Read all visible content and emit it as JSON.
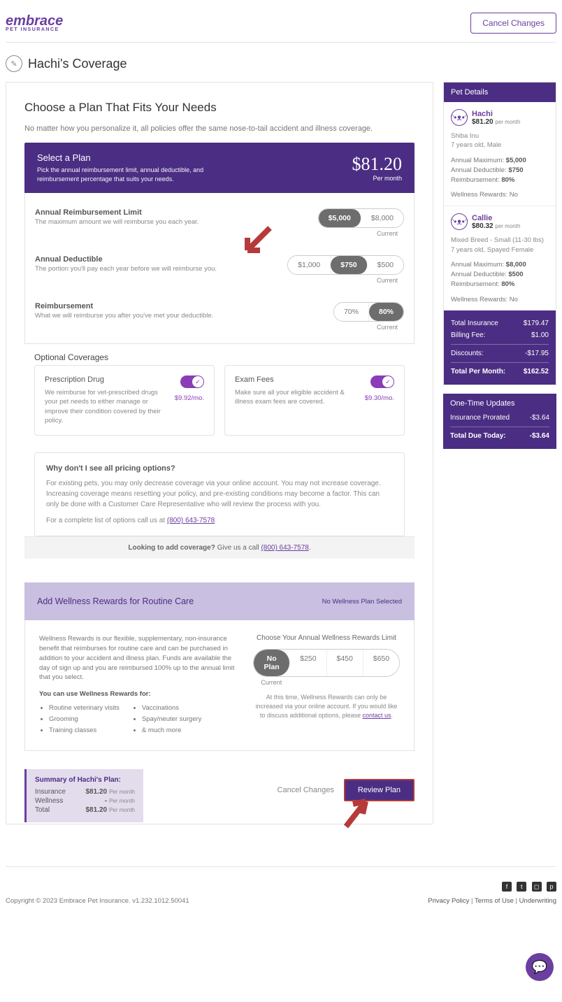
{
  "header": {
    "brand": "embrace",
    "brand_sub": "PET INSURANCE",
    "cancel": "Cancel Changes"
  },
  "page_title": "Hachi's Coverage",
  "main": {
    "heading": "Choose a Plan That Fits Your Needs",
    "intro": "No matter how you personalize it, all policies offer the same nose-to-tail accident and illness coverage.",
    "plan_header_title": "Select a Plan",
    "plan_header_sub": "Pick the annual reimbursement limit, annual deductible, and reimbursement percentage that suits your needs.",
    "plan_price": "$81.20",
    "plan_price_sub": "Per month",
    "reimb_limit_title": "Annual Reimbursement Limit",
    "reimb_limit_sub": "The maximum amount we will reimburse you each year.",
    "reimb_limit_options": [
      "$5,000",
      "$8,000"
    ],
    "deductible_title": "Annual Deductible",
    "deductible_sub": "The portion you'll pay each year before we will reimburse you.",
    "deductible_options": [
      "$1,000",
      "$750",
      "$500"
    ],
    "reimb_title": "Reimbursement",
    "reimb_sub": "What we will reimburse you after you've met your deductible.",
    "reimb_options": [
      "70%",
      "80%"
    ],
    "current": "Current",
    "optional_title": "Optional Coverages",
    "cov1_title": "Prescription Drug",
    "cov1_desc": "We reimburse for vet-prescribed drugs your pet needs to either manage or improve their condition covered by their policy.",
    "cov1_price": "$9.92/mo.",
    "cov2_title": "Exam Fees",
    "cov2_desc": "Make sure all your eligible accident & illness exam fees are covered.",
    "cov2_price": "$9.30/mo.",
    "info_title": "Why don't I see all pricing options?",
    "info_text": "For existing pets, you may only decrease coverage via your online account. You may not increase coverage. Increasing coverage means resetting your policy, and pre-existing conditions may become a factor. This can only be done with a Customer Care Representative who will review the process with you.",
    "info_phone_pre": "For a complete list of options call us at ",
    "info_phone": "(800) 643-7578",
    "add_cov_pre": "Looking to add coverage? ",
    "add_cov_mid": "Give us a call ",
    "add_cov_phone": "(800) 643-7578",
    "wellness_heading": "Add Wellness Rewards for Routine Care",
    "wellness_status": "No Wellness Plan Selected",
    "wellness_desc": "Wellness Rewards is our flexible, supplementary, non-insurance benefit that reimburses for routine care and can be purchased in addition to your accident and illness plan. Funds are available the day of sign up and you are reimbursed 100% up to the annual limit that you select.",
    "wellness_uses_title": "You can use Wellness Rewards for:",
    "wellness_uses_col1": [
      "Routine veterinary visits",
      "Grooming",
      "Training classes"
    ],
    "wellness_uses_col2": [
      "Vaccinations",
      "Spay/neuter surgery",
      "& much more"
    ],
    "wellness_right_title": "Choose Your Annual Wellness Rewards Limit",
    "wellness_options": [
      "No Plan",
      "$250",
      "$450",
      "$650"
    ],
    "wellness_note_pre": "At this time, Wellness Rewards can only be increased via your online account. If you would like to discuss additional options, please ",
    "wellness_note_link": "contact us",
    "summary_title": "Summary of Hachi's Plan:",
    "summary_rows": [
      {
        "label": "Insurance",
        "amt": "$81.20",
        "per": "Per month"
      },
      {
        "label": "Wellness",
        "amt": "-",
        "per": "Per month"
      },
      {
        "label": "Total",
        "amt": "$81.20",
        "per": "Per month"
      }
    ],
    "cancel_changes": "Cancel Changes",
    "review_plan": "Review Plan"
  },
  "sidebar": {
    "pet_details": "Pet Details",
    "pets": [
      {
        "name": "Hachi",
        "price": "$81.20",
        "per": "per month",
        "breed": "Shiba Inu",
        "age": "7 years old, Male",
        "max_label": "Annual Maximum:",
        "max": "$5,000",
        "ded_label": "Annual Deductible:",
        "ded": "$750",
        "reimb_label": "Reimbursement:",
        "reimb": "80%",
        "wr_label": "Wellness Rewards:",
        "wr": "No"
      },
      {
        "name": "Callie",
        "price": "$80.32",
        "per": "per month",
        "breed": "Mixed Breed - Small (11-30 lbs)",
        "age": "7 years old, Spayed Female",
        "max_label": "Annual Maximum:",
        "max": "$8,000",
        "ded_label": "Annual Deductible:",
        "ded": "$500",
        "reimb_label": "Reimbursement:",
        "reimb": "80%",
        "wr_label": "Wellness Rewards:",
        "wr": "No"
      }
    ],
    "totals": {
      "ins_label": "Total Insurance",
      "ins": "$179.47",
      "bill_label": "Billing Fee:",
      "bill": "$1.00",
      "disc_label": "Discounts:",
      "disc": "-$17.95",
      "tpm_label": "Total Per Month:",
      "tpm": "$162.52"
    },
    "onetime_head": "One-Time Updates",
    "onetime": {
      "pro_label": "Insurance Prorated",
      "pro": "-$3.64",
      "due_label": "Total Due Today:",
      "due": "-$3.64"
    }
  },
  "footer": {
    "copyright": "Copyright © 2023   Embrace Pet Insurance. v1.232.1012.50041",
    "privacy": "Privacy Policy",
    "terms": "Terms of Use",
    "under": "Underwriting"
  }
}
